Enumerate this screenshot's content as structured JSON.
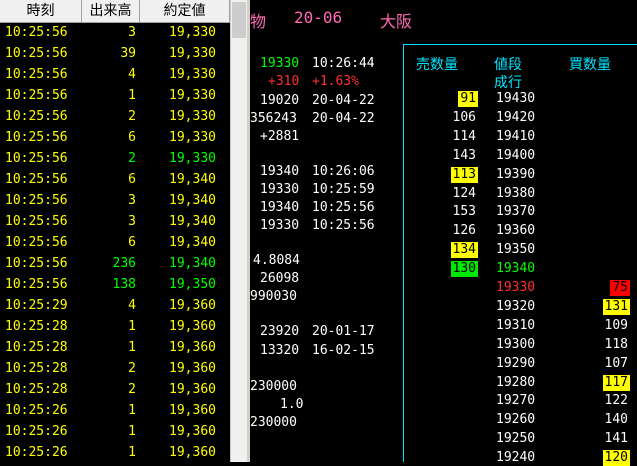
{
  "tick": {
    "headers": {
      "time": "時刻",
      "volume": "出来高",
      "price": "約定値"
    },
    "rows": [
      {
        "time": "10:25:56",
        "vol": "3",
        "price": "19,330",
        "color": "yellow"
      },
      {
        "time": "10:25:56",
        "vol": "39",
        "price": "19,330",
        "color": "yellow"
      },
      {
        "time": "10:25:56",
        "vol": "4",
        "price": "19,330",
        "color": "yellow"
      },
      {
        "time": "10:25:56",
        "vol": "1",
        "price": "19,330",
        "color": "yellow"
      },
      {
        "time": "10:25:56",
        "vol": "2",
        "price": "19,330",
        "color": "yellow"
      },
      {
        "time": "10:25:56",
        "vol": "6",
        "price": "19,330",
        "color": "yellow"
      },
      {
        "time": "10:25:56",
        "vol": "2",
        "price": "19,330",
        "color": "green"
      },
      {
        "time": "10:25:56",
        "vol": "6",
        "price": "19,340",
        "color": "yellow"
      },
      {
        "time": "10:25:56",
        "vol": "3",
        "price": "19,340",
        "color": "yellow"
      },
      {
        "time": "10:25:56",
        "vol": "3",
        "price": "19,340",
        "color": "yellow"
      },
      {
        "time": "10:25:56",
        "vol": "6",
        "price": "19,340",
        "color": "yellow"
      },
      {
        "time": "10:25:56",
        "vol": "236",
        "price": "19,340",
        "color": "green"
      },
      {
        "time": "10:25:56",
        "vol": "138",
        "price": "19,350",
        "color": "green"
      },
      {
        "time": "10:25:29",
        "vol": "4",
        "price": "19,360",
        "color": "yellow"
      },
      {
        "time": "10:25:28",
        "vol": "1",
        "price": "19,360",
        "color": "yellow"
      },
      {
        "time": "10:25:28",
        "vol": "1",
        "price": "19,360",
        "color": "yellow"
      },
      {
        "time": "10:25:28",
        "vol": "2",
        "price": "19,360",
        "color": "yellow"
      },
      {
        "time": "10:25:28",
        "vol": "2",
        "price": "19,360",
        "color": "yellow"
      },
      {
        "time": "10:25:26",
        "vol": "1",
        "price": "19,360",
        "color": "yellow"
      },
      {
        "time": "10:25:26",
        "vol": "1",
        "price": "19,360",
        "color": "yellow"
      },
      {
        "time": "10:25:26",
        "vol": "1",
        "price": "19,360",
        "color": "yellow"
      }
    ]
  },
  "header": {
    "partial_title": "物",
    "contract": "20-06",
    "exchange": "大阪"
  },
  "quote": {
    "last_price": "19330",
    "last_time": "10:26:44",
    "change": "+310",
    "change_pct": "+1.63%",
    "high_val": "19020",
    "high_date": "20-04-22",
    "vol_val": "356243",
    "vol_date": "20-04-22",
    "misc": "+2881",
    "p1": "19340",
    "t1": "10:26:06",
    "p2": "19330",
    "t2": "10:25:59",
    "p3": "19340",
    "t3": "10:25:56",
    "p4": "19330",
    "t4": "10:25:56",
    "ratio": "4.8084",
    "n1": "26098",
    "n2": "990030",
    "h1": "23920",
    "hd1": "20-01-17",
    "h2": "13320",
    "hd2": "16-02-15",
    "n3": "230000",
    "n4": "1.0",
    "n5": "230000"
  },
  "board": {
    "headers": {
      "sell": "売数量",
      "price": "値段",
      "market": "成行",
      "buy": "買数量"
    },
    "rows": [
      {
        "sell": "91",
        "sell_hl": "y",
        "price": "19430",
        "price_color": "white",
        "buy": "",
        "buy_hl": ""
      },
      {
        "sell": "106",
        "sell_hl": "",
        "price": "19420",
        "price_color": "white",
        "buy": "",
        "buy_hl": ""
      },
      {
        "sell": "114",
        "sell_hl": "",
        "price": "19410",
        "price_color": "white",
        "buy": "",
        "buy_hl": ""
      },
      {
        "sell": "143",
        "sell_hl": "",
        "price": "19400",
        "price_color": "white",
        "buy": "",
        "buy_hl": ""
      },
      {
        "sell": "113",
        "sell_hl": "y",
        "price": "19390",
        "price_color": "white",
        "buy": "",
        "buy_hl": ""
      },
      {
        "sell": "124",
        "sell_hl": "",
        "price": "19380",
        "price_color": "white",
        "buy": "",
        "buy_hl": ""
      },
      {
        "sell": "153",
        "sell_hl": "",
        "price": "19370",
        "price_color": "white",
        "buy": "",
        "buy_hl": ""
      },
      {
        "sell": "126",
        "sell_hl": "",
        "price": "19360",
        "price_color": "white",
        "buy": "",
        "buy_hl": ""
      },
      {
        "sell": "134",
        "sell_hl": "y",
        "price": "19350",
        "price_color": "white",
        "buy": "",
        "buy_hl": ""
      },
      {
        "sell": "130",
        "sell_hl": "g",
        "price": "19340",
        "price_color": "green",
        "buy": "",
        "buy_hl": ""
      },
      {
        "sell": "",
        "sell_hl": "",
        "price": "19330",
        "price_color": "red",
        "buy": "75",
        "buy_hl": "r"
      },
      {
        "sell": "",
        "sell_hl": "",
        "price": "19320",
        "price_color": "white",
        "buy": "131",
        "buy_hl": "y"
      },
      {
        "sell": "",
        "sell_hl": "",
        "price": "19310",
        "price_color": "white",
        "buy": "109",
        "buy_hl": ""
      },
      {
        "sell": "",
        "sell_hl": "",
        "price": "19300",
        "price_color": "white",
        "buy": "118",
        "buy_hl": ""
      },
      {
        "sell": "",
        "sell_hl": "",
        "price": "19290",
        "price_color": "white",
        "buy": "107",
        "buy_hl": ""
      },
      {
        "sell": "",
        "sell_hl": "",
        "price": "19280",
        "price_color": "white",
        "buy": "117",
        "buy_hl": "y"
      },
      {
        "sell": "",
        "sell_hl": "",
        "price": "19270",
        "price_color": "white",
        "buy": "122",
        "buy_hl": ""
      },
      {
        "sell": "",
        "sell_hl": "",
        "price": "19260",
        "price_color": "white",
        "buy": "140",
        "buy_hl": ""
      },
      {
        "sell": "",
        "sell_hl": "",
        "price": "19250",
        "price_color": "white",
        "buy": "141",
        "buy_hl": ""
      },
      {
        "sell": "",
        "sell_hl": "",
        "price": "19240",
        "price_color": "white",
        "buy": "120",
        "buy_hl": "y"
      }
    ]
  },
  "colors": {
    "pink": "#ff69b4",
    "cyan": "#00e5ff",
    "yellow": "#ffff00",
    "green": "#00ff00",
    "red": "#ff3030"
  }
}
